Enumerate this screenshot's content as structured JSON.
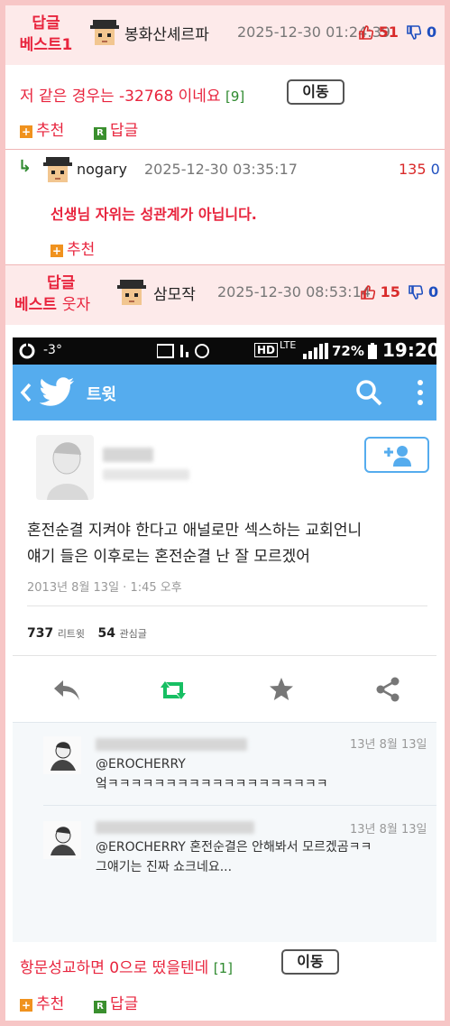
{
  "post1": {
    "best_label_line1": "답글",
    "best_label_line2": "베스트1",
    "author": "봉화산셰르파",
    "datetime": "2025-12-30 01:24:39",
    "upvotes": "51",
    "downvotes": "0",
    "text": "저 같은 경우는 -32768 이네요",
    "reply_count": "[9]",
    "move_label": "이동",
    "recommend_label": "추천",
    "reply_label": "답글",
    "plus_glyph": "+",
    "r_glyph": "R"
  },
  "reply1": {
    "author": "nogary",
    "datetime": "2025-12-30 03:35:17",
    "upvotes": "135",
    "downvotes": "0",
    "text": "선생님 자위는 성관계가 아닙니다.",
    "recommend_label": "추천",
    "plus_glyph": "+"
  },
  "post2": {
    "best_label_line1": "답글",
    "best_label_line2": "베스트",
    "best_label_tag": "웃자",
    "author": "삼모작",
    "datetime": "2025-12-30 08:53:14",
    "upvotes": "15",
    "downvotes": "0",
    "text": "항문성교하면 0으로 떴을텐데",
    "reply_count": "[1]",
    "move_label": "이동",
    "recommend_label": "추천",
    "reply_label": "답글",
    "plus_glyph": "+",
    "r_glyph": "R"
  },
  "embedded_screenshot": {
    "status_signal_text": "-3°",
    "status_battery": "72%",
    "status_time": "19:20",
    "status_lte": "LTE",
    "status_hd": "HD",
    "app_title": "트윗",
    "tweet_text_line1": "혼전순결 지켜야 한다고 애널로만 섹스하는 교회언니",
    "tweet_text_line2": "얘기 들은 이후로는 혼전순결 난 잘 모르겠어",
    "tweet_date": "2013년 8월 13일 · 1:45 오후",
    "retweets_count": "737",
    "retweets_label": "리트윗",
    "favorites_count": "54",
    "favorites_label": "관심글",
    "reply_a": {
      "date": "13년 8월 13일",
      "mention": "@EROCHERRY",
      "text": "엌ㅋㅋㅋㅋㅋㅋㅋㅋㅋㅋㅋㅋㅋㅋㅋㅋㅋㅋㅋ"
    },
    "reply_b": {
      "date": "13년 8월 13일",
      "line1": "@EROCHERRY 혼전순결은 안해봐서 모르겠곰ㅋㅋ",
      "line2": "그얘기는 진짜 쇼크네요..."
    }
  },
  "colors": {
    "accent_red": "#e8243d",
    "header_pink": "#fdeaea",
    "border_pink": "#f7c6c6",
    "reply_green": "#2f8a2f",
    "twitter_blue": "#55acee",
    "retweet_green": "#17bf63"
  }
}
